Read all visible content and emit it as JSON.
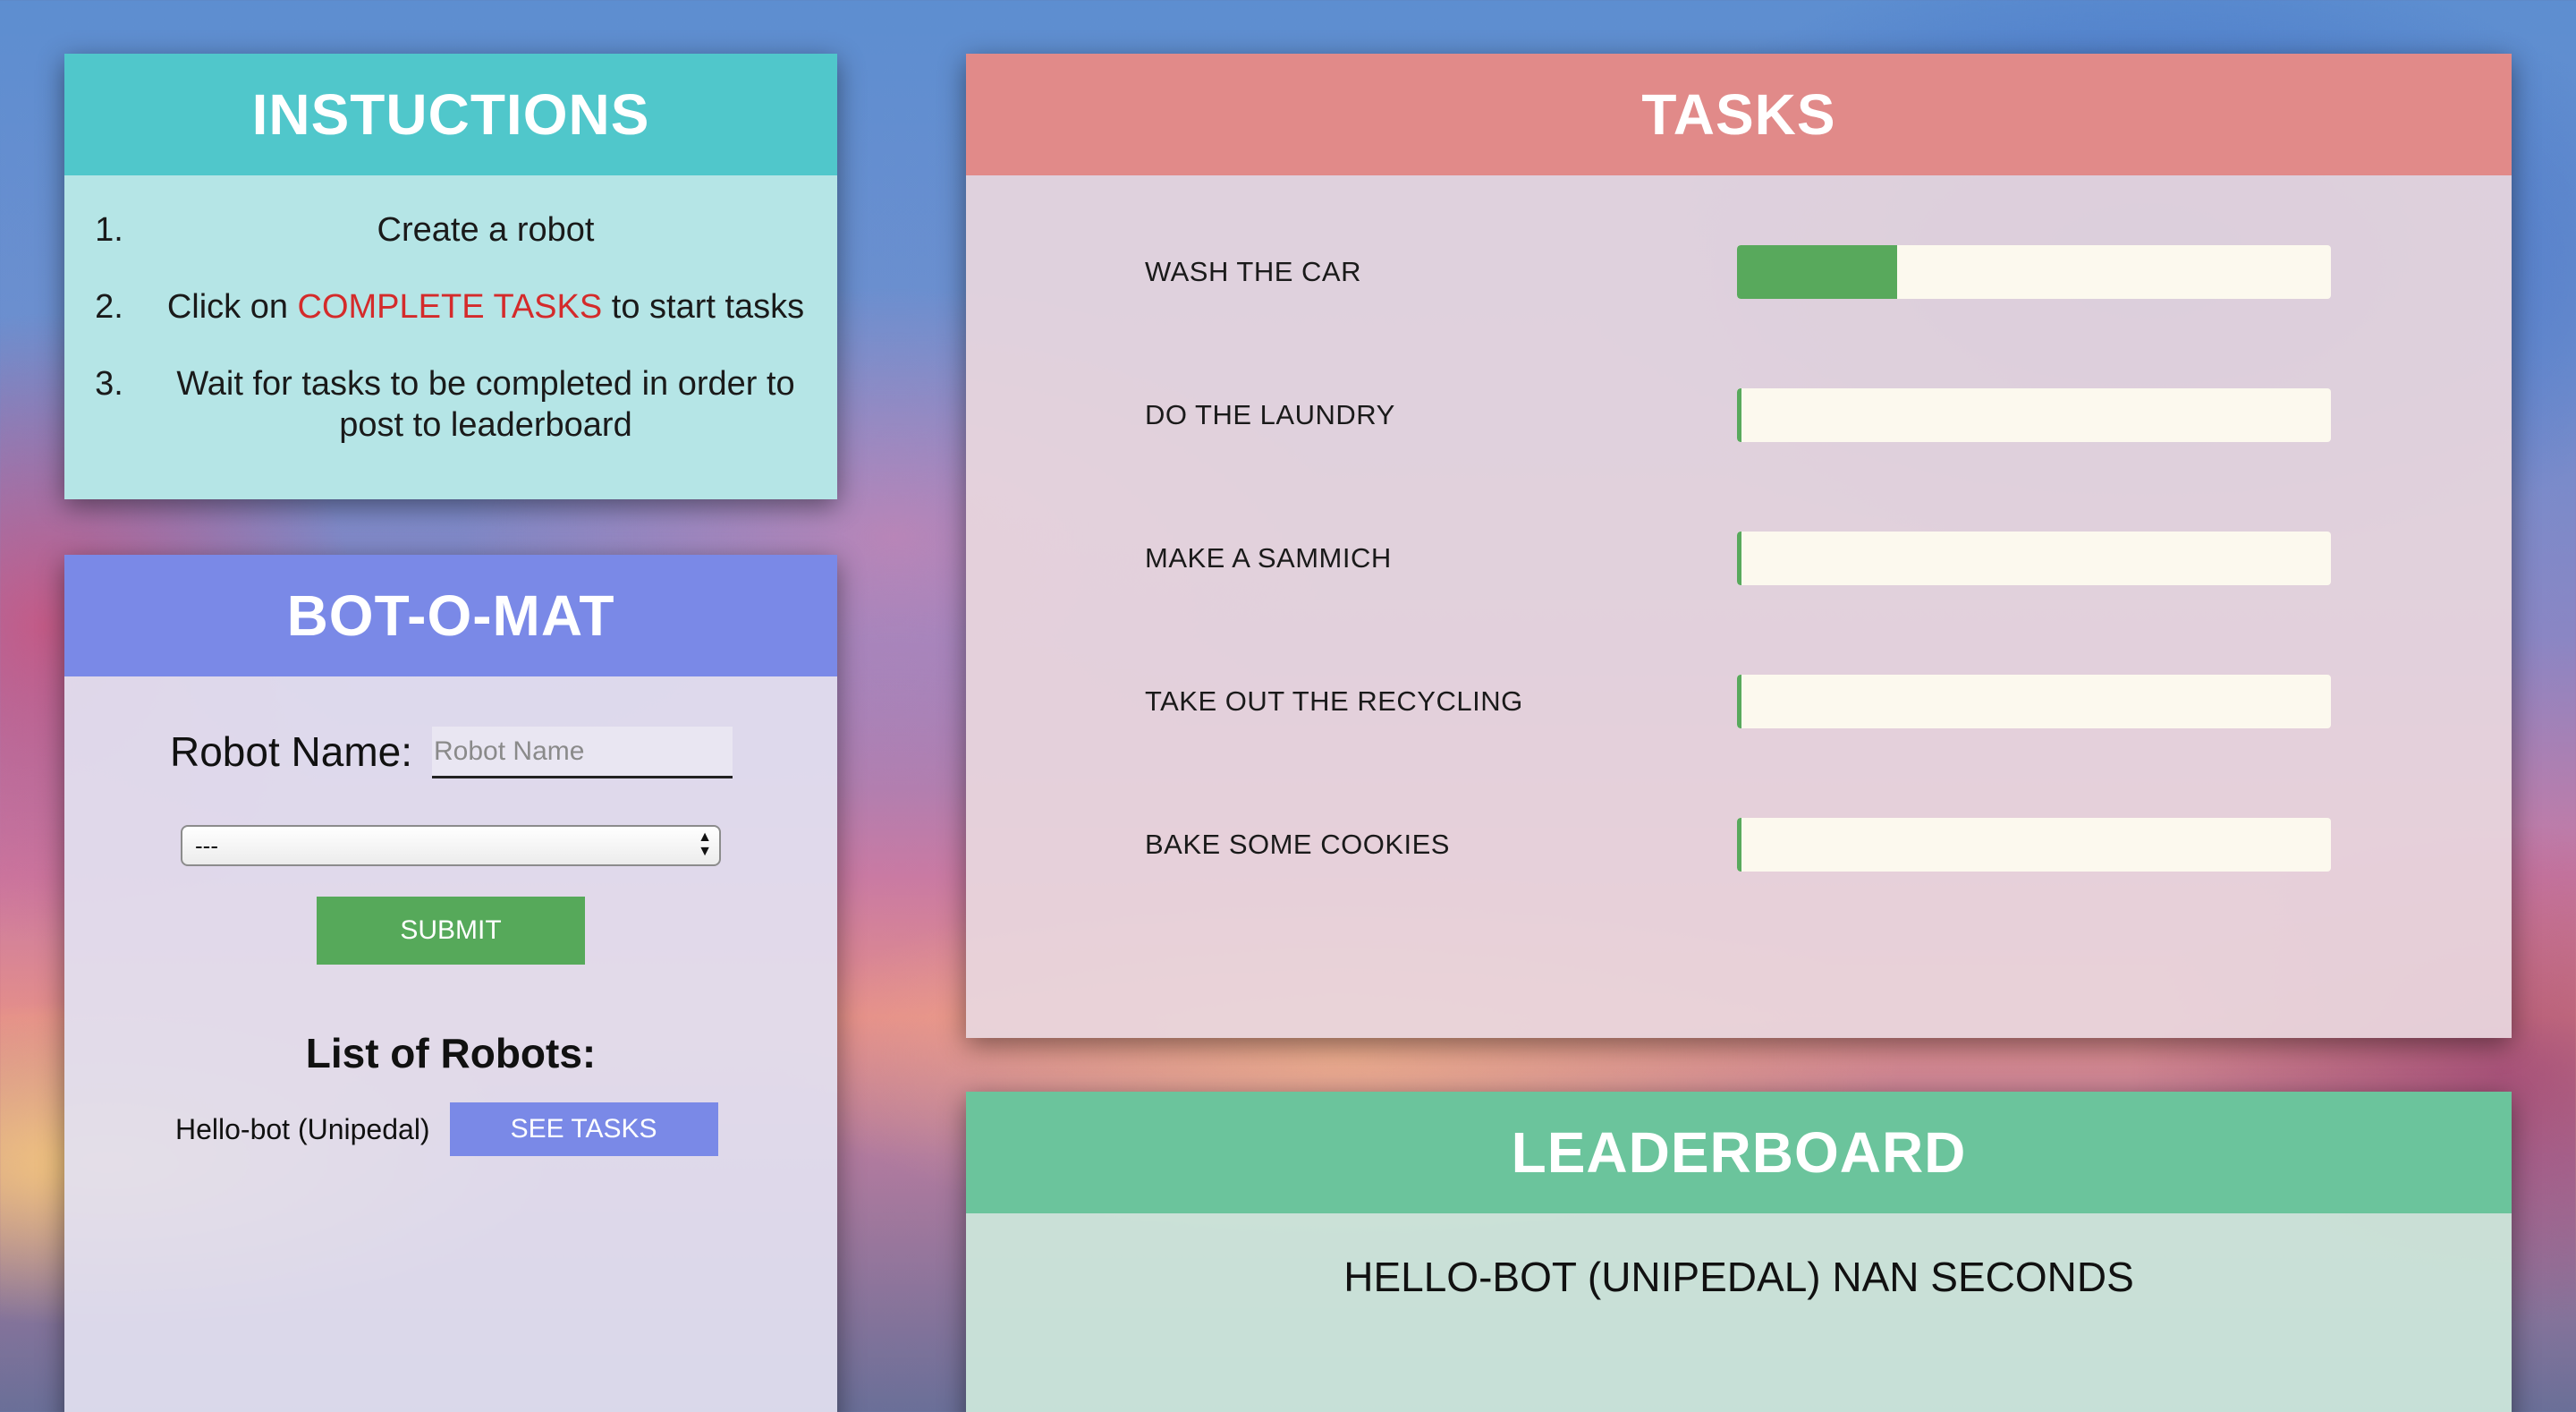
{
  "instructions": {
    "title": "INSTUCTIONS",
    "steps": [
      {
        "num": "1.",
        "text": "Create a robot"
      },
      {
        "num": "2.",
        "before": "Click on ",
        "highlight": "COMPLETE TASKS",
        "after": " to start tasks"
      },
      {
        "num": "3.",
        "text": "Wait for tasks to be completed in order to post to leaderboard"
      }
    ],
    "highlight_color": "#d42b2b"
  },
  "botomat": {
    "title": "BOT-O-MAT",
    "name_label": "Robot Name:",
    "name_placeholder": "Robot Name",
    "name_value": "",
    "type_select_value": "---",
    "submit_label": "SUBMIT",
    "list_title": "List of Robots:",
    "robots": [
      {
        "name": "Hello-bot (Unipedal)",
        "button_label": "SEE TASKS"
      }
    ]
  },
  "tasks": {
    "title": "TASKS",
    "items": [
      {
        "label": "WASH THE CAR",
        "progress": 0.27
      },
      {
        "label": "DO THE LAUNDRY",
        "progress": 0.0
      },
      {
        "label": "MAKE A SAMMICH",
        "progress": 0.0
      },
      {
        "label": "TAKE OUT THE RECYCLING",
        "progress": 0.0
      },
      {
        "label": "BAKE SOME COOKIES",
        "progress": 0.0
      }
    ]
  },
  "leaderboard": {
    "title": "LEADERBOARD",
    "entries": [
      "HELLO-BOT (UNIPEDAL) NAN SECONDS"
    ]
  },
  "colors": {
    "instructions_header": "#50c7cb",
    "botomat_header": "#7a89e7",
    "tasks_header": "#e18a89",
    "leaderboard_header": "#6bc49c",
    "progress_fill": "#58a95c",
    "submit_button": "#56a95a"
  }
}
